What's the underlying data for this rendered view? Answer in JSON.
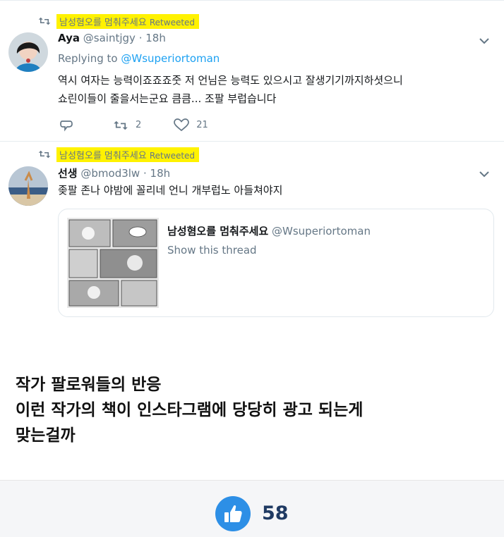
{
  "tweets": [
    {
      "retweet_label": "남성혐오를 멈춰주세요",
      "retweet_tag": "Retweeted",
      "name": "Aya",
      "handle": "@saintjgy",
      "separator": "·",
      "time": "18h",
      "replying_prefix": "Replying to",
      "replying_to": "@Wsuperiortoman",
      "text_line1": "역시 여자는 능력이죠죠죠줏 저 언님은 능력도 있으시고 잘생기기까지하셧으니",
      "text_line2": "쇼린이들이 줄을서는군요 큼큼... 조팔 부럽습니다",
      "retweets": "2",
      "likes": "21"
    },
    {
      "retweet_label": "남성혐오를 멈춰주세요",
      "retweet_tag": "Retweeted",
      "name": "선생",
      "handle": "@bmod3lw",
      "separator": "·",
      "time": "18h",
      "text": "좆팔 존나 야밤에 꼴리네 언니 개부럽노 아들쳐야지",
      "quoted": {
        "name": "남성혐오를 멈춰주세요",
        "handle": "@Wsuperiortoman",
        "show_thread": "Show this thread"
      }
    }
  ],
  "caption": {
    "line1": "작가 팔로워들의 반응",
    "line2": "이런 작가의 책이 인스타그램에 당당히 광고 되는게",
    "line3": "맞는걸까"
  },
  "footer": {
    "like_count": "58"
  },
  "icons": {
    "retweet": "retweet-icon",
    "chevron": "chevron-down-icon",
    "reply": "reply-icon",
    "like": "heart-icon",
    "thumbs": "thumbs-up-icon"
  },
  "colors": {
    "highlight": "#fff200",
    "link": "#1da1f2",
    "muted": "#657786",
    "like_button": "#2d8fe6",
    "like_count": "#1f3a63"
  }
}
